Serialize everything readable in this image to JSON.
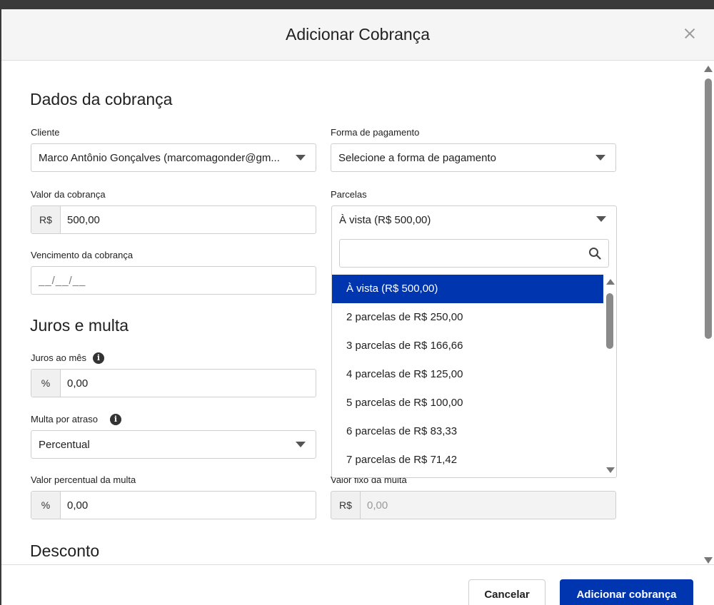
{
  "modal": {
    "title": "Adicionar Cobrança"
  },
  "sections": {
    "dados": "Dados da cobrança",
    "juros": "Juros e multa",
    "desconto": "Desconto"
  },
  "fields": {
    "cliente": {
      "label": "Cliente",
      "value": "Marco Antônio Gonçalves (marcomagonder@gm..."
    },
    "forma_pagamento": {
      "label": "Forma de pagamento",
      "value": "Selecione a forma de pagamento"
    },
    "valor": {
      "label": "Valor da cobrança",
      "prefix": "R$",
      "value": "500,00"
    },
    "parcelas": {
      "label": "Parcelas",
      "value": "À vista (R$ 500,00)"
    },
    "vencimento": {
      "label": "Vencimento da cobrança",
      "placeholder": "__/__/__"
    },
    "juros_mes": {
      "label": "Juros ao mês",
      "prefix": "%",
      "value": "0,00"
    },
    "multa_atraso": {
      "label": "Multa por atraso",
      "value": "Percentual"
    },
    "valor_percentual_multa": {
      "label": "Valor percentual da multa",
      "prefix": "%",
      "value": "0,00"
    },
    "valor_fixo_multa": {
      "label": "Valor fixo da multa",
      "prefix": "R$",
      "value": "0,00"
    }
  },
  "parcelas_options": [
    "À vista (R$ 500,00)",
    "2 parcelas de R$ 250,00",
    "3 parcelas de R$ 166,66",
    "4 parcelas de R$ 125,00",
    "5 parcelas de R$ 100,00",
    "6 parcelas de R$ 83,33",
    "7 parcelas de R$ 71,42"
  ],
  "footer": {
    "cancel_label": "Cancelar",
    "submit_label": "Adicionar cobrança"
  },
  "colors": {
    "primary": "#0035b0",
    "header_bg": "#f5f5f5"
  }
}
